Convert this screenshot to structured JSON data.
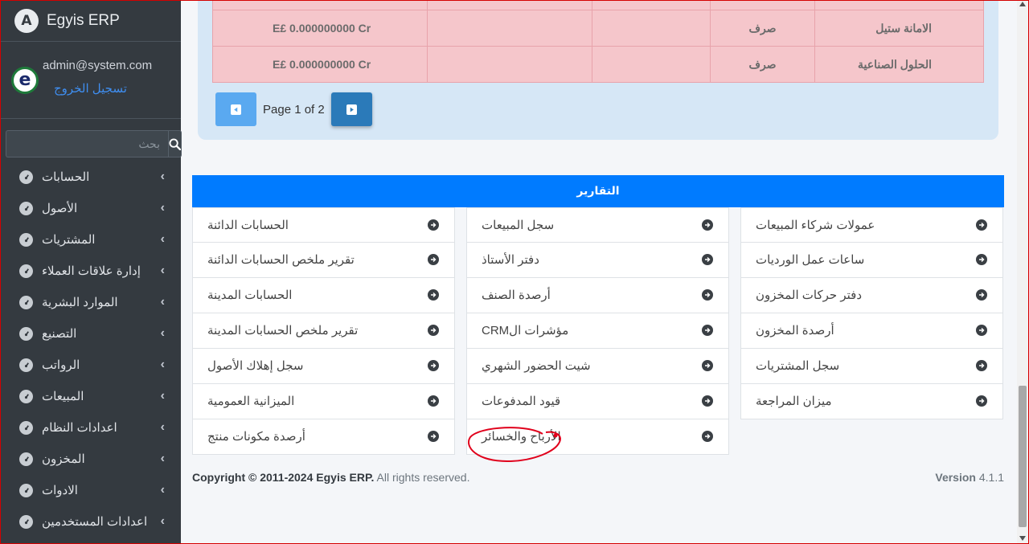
{
  "brand": {
    "name": "Egyis ERP",
    "logo_letter": "A"
  },
  "user": {
    "email": "admin@system.com",
    "logout_label": "تسجيل الخروج",
    "avatar_letter": "e"
  },
  "search": {
    "placeholder": "بحث"
  },
  "sidebar": {
    "items": [
      {
        "label": "الحسابات"
      },
      {
        "label": "الأصول"
      },
      {
        "label": "المشتريات"
      },
      {
        "label": "إدارة علاقات العملاء"
      },
      {
        "label": "الموارد البشرية"
      },
      {
        "label": "التصنيع"
      },
      {
        "label": "الرواتب"
      },
      {
        "label": "المبيعات"
      },
      {
        "label": "اعدادات النظام"
      },
      {
        "label": "المخزون"
      },
      {
        "label": "الادوات"
      },
      {
        "label": "اعدادات المستخدمين"
      }
    ]
  },
  "ledger": {
    "rows": [
      {
        "amount": "E£ 0.000000000 Cr",
        "col2": "",
        "col3": "",
        "type": "صرف",
        "name": "الامانة ستيل"
      },
      {
        "amount": "E£ 0.000000000 Cr",
        "col2": "",
        "col3": "",
        "type": "صرف",
        "name": "الحلول الصناعية"
      }
    ]
  },
  "pagination": {
    "text": "Page 1 of 2"
  },
  "reports": {
    "title": "التقارير",
    "columns": [
      [
        {
          "label": "الحسابات الدائنة"
        },
        {
          "label": "تقرير ملخص الحسابات الدائنة"
        },
        {
          "label": "الحسابات المدينة"
        },
        {
          "label": "تقرير ملخص الحسابات المدينة"
        },
        {
          "label": "سجل إهلاك الأصول"
        },
        {
          "label": "الميزانية العمومية"
        },
        {
          "label": "أرصدة مكونات منتج"
        }
      ],
      [
        {
          "label": "سجل المبيعات"
        },
        {
          "label": "دفتر الأستاذ"
        },
        {
          "label": "أرصدة الصنف"
        },
        {
          "label": "مؤشرات الCRM"
        },
        {
          "label": "شيت الحضور الشهري"
        },
        {
          "label": "قيود المدفوعات"
        },
        {
          "label": "الأرباح والخسائر"
        }
      ],
      [
        {
          "label": "عمولات شركاء المبيعات"
        },
        {
          "label": "ساعات عمل الورديات"
        },
        {
          "label": "دفتر حركات المخزون"
        },
        {
          "label": "أرصدة المخزون"
        },
        {
          "label": "سجل المشتريات"
        },
        {
          "label": "ميزان المراجعة"
        }
      ]
    ]
  },
  "footer": {
    "copyright_prefix": "Copyright © 2011-2024",
    "copyright_brand": "Egyis ERP.",
    "copyright_suffix": "All rights reserved.",
    "version_label": "Version",
    "version_number": "4.1.1"
  },
  "colors": {
    "sidebar_bg": "#343a40",
    "accent": "#007bff",
    "ledger_row": "#f5c6cb",
    "highlight_ring": "#e0001b"
  }
}
